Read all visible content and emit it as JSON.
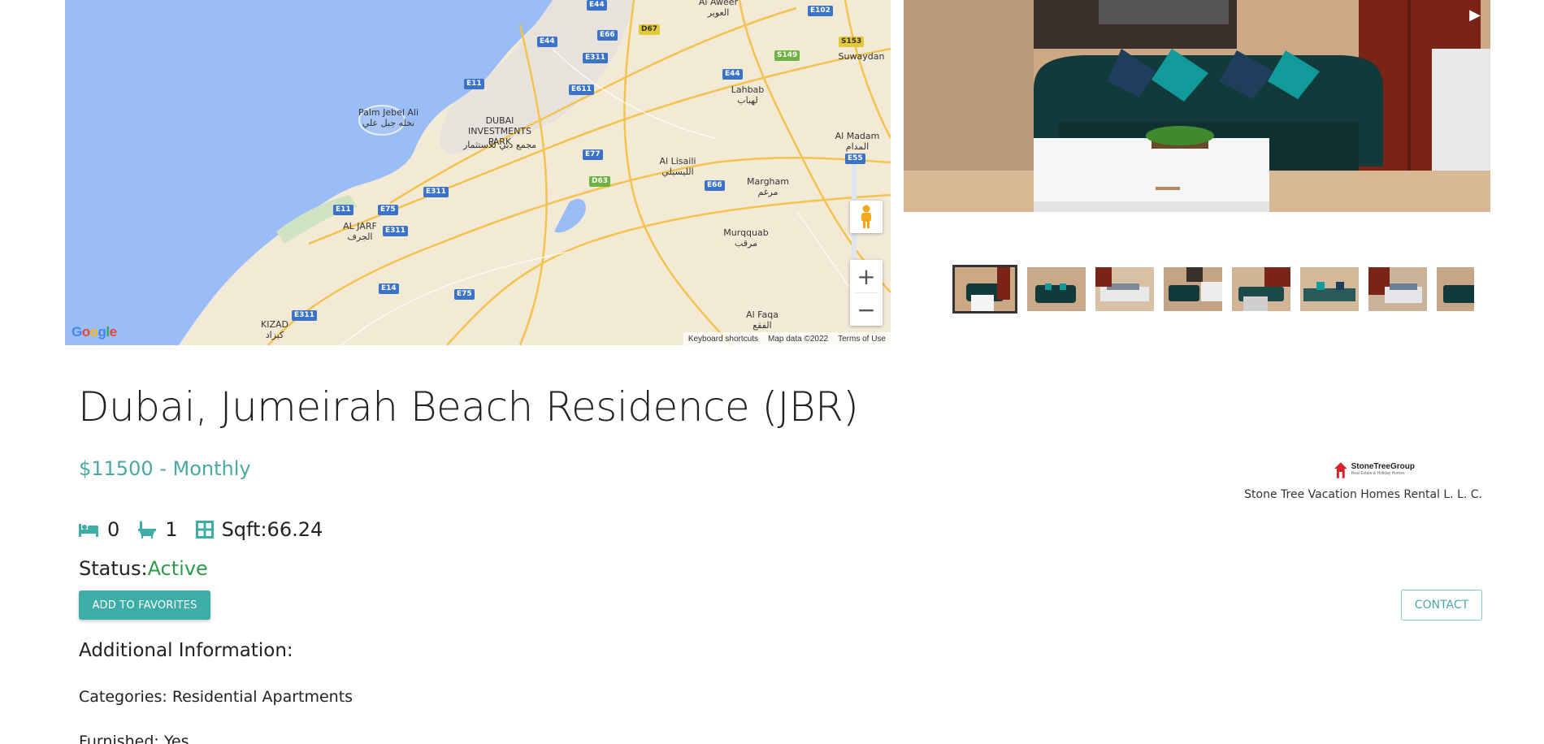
{
  "map": {
    "places": [
      {
        "name": "Palm Jebel Ali",
        "arabic": "نخله جبل علي"
      },
      {
        "name": "DUBAI INVESTMENTS PARK",
        "arabic": "مجمع دبي للاستثمار"
      },
      {
        "name": "Al Lisaili",
        "arabic": "الليسيلي"
      },
      {
        "name": "Lahbab",
        "arabic": "لهباب"
      },
      {
        "name": "Suwaydan",
        "arabic": ""
      },
      {
        "name": "Al Madam",
        "arabic": "المدام"
      },
      {
        "name": "Margham",
        "arabic": "مرغم"
      },
      {
        "name": "Murqquab",
        "arabic": "مرقب"
      },
      {
        "name": "AL JARF",
        "arabic": "الجرف"
      },
      {
        "name": "KIZAD",
        "arabic": "كيزاد"
      },
      {
        "name": "Al Faqa",
        "arabic": "الفقع"
      },
      {
        "name": "Al Aweer",
        "arabic": "العوير"
      }
    ],
    "roads": [
      "E44",
      "E66",
      "E311",
      "D67",
      "E102",
      "S153",
      "S149",
      "E11",
      "E611",
      "E77",
      "D63",
      "E66",
      "E311",
      "E55",
      "E11",
      "E75",
      "E311",
      "E14",
      "E75",
      "E311",
      "E44",
      "E44"
    ],
    "google_logo": "Google",
    "footer": {
      "keyboard": "Keyboard shortcuts",
      "mapdata": "Map data ©2022",
      "terms": "Terms of Use"
    },
    "zoom_in": "+",
    "zoom_out": "−"
  },
  "gallery": {
    "thumbnail_count": 8,
    "active_index": 0,
    "next_arrow": "▶"
  },
  "listing": {
    "title": "Dubai, Jumeirah Beach Residence (JBR)",
    "price": "$11500 - Monthly",
    "bedrooms": "0",
    "bathrooms": "1",
    "area": "Sqft:66.24",
    "status_label": "Status:",
    "status_value": "Active",
    "favorites_button": "ADD TO FAVORITES",
    "additional_heading": "Additional Information:",
    "categories_label": "Categories:",
    "categories_value": "Residential Apartments",
    "furnished": "Furnished: Yes"
  },
  "agency": {
    "logo_name": "StoneTreeGroup",
    "logo_tagline": "Real Estate & Holiday Homes",
    "name": "Stone Tree Vacation Homes Rental L. L. C.",
    "contact_button": "CONTACT"
  },
  "colors": {
    "accent": "#3cada7",
    "price": "#4aa9a4",
    "status_active": "#2e9c4a",
    "sea": "#9bbdf7",
    "land": "#f3ead6"
  }
}
